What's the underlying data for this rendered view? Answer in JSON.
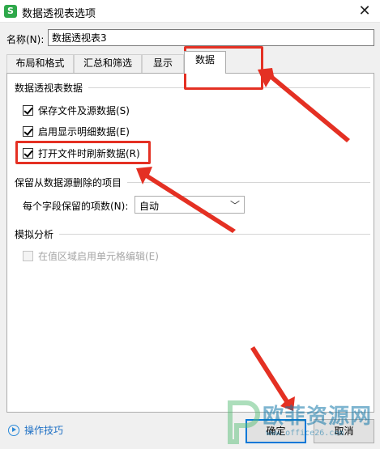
{
  "window": {
    "title": "数据透视表选项",
    "app_icon_letter": "S",
    "close_glyph": "✕"
  },
  "name_field": {
    "label": "名称(N):",
    "value": "数据透视表3"
  },
  "tabs": [
    {
      "label": "布局和格式",
      "active": false
    },
    {
      "label": "汇总和筛选",
      "active": false
    },
    {
      "label": "显示",
      "active": false
    },
    {
      "label": "数据",
      "active": true
    }
  ],
  "section_pivot_data": {
    "title": "数据透视表数据",
    "options": [
      {
        "label": "保存文件及源数据(S)",
        "checked": true
      },
      {
        "label": "启用显示明细数据(E)",
        "checked": true
      },
      {
        "label": "打开文件时刷新数据(R)",
        "checked": true
      }
    ]
  },
  "section_retain": {
    "title": "保留从数据源删除的项目",
    "items_label": "每个字段保留的项数(N):",
    "items_value": "自动"
  },
  "section_whatif": {
    "title": "模拟分析",
    "option": {
      "label": "在值区域启用单元格编辑(E)",
      "checked": false,
      "disabled": true
    }
  },
  "footer": {
    "tips_label": "操作技巧",
    "ok_label": "确定",
    "cancel_label": "取消"
  },
  "watermark": {
    "text": "欧菲资源网",
    "url_text": "www.office26.com"
  },
  "colors": {
    "annotation_red": "#e43023",
    "primary_blue": "#0078d7",
    "tips_blue": "#1d6fc4",
    "app_green": "#2ea84a"
  }
}
